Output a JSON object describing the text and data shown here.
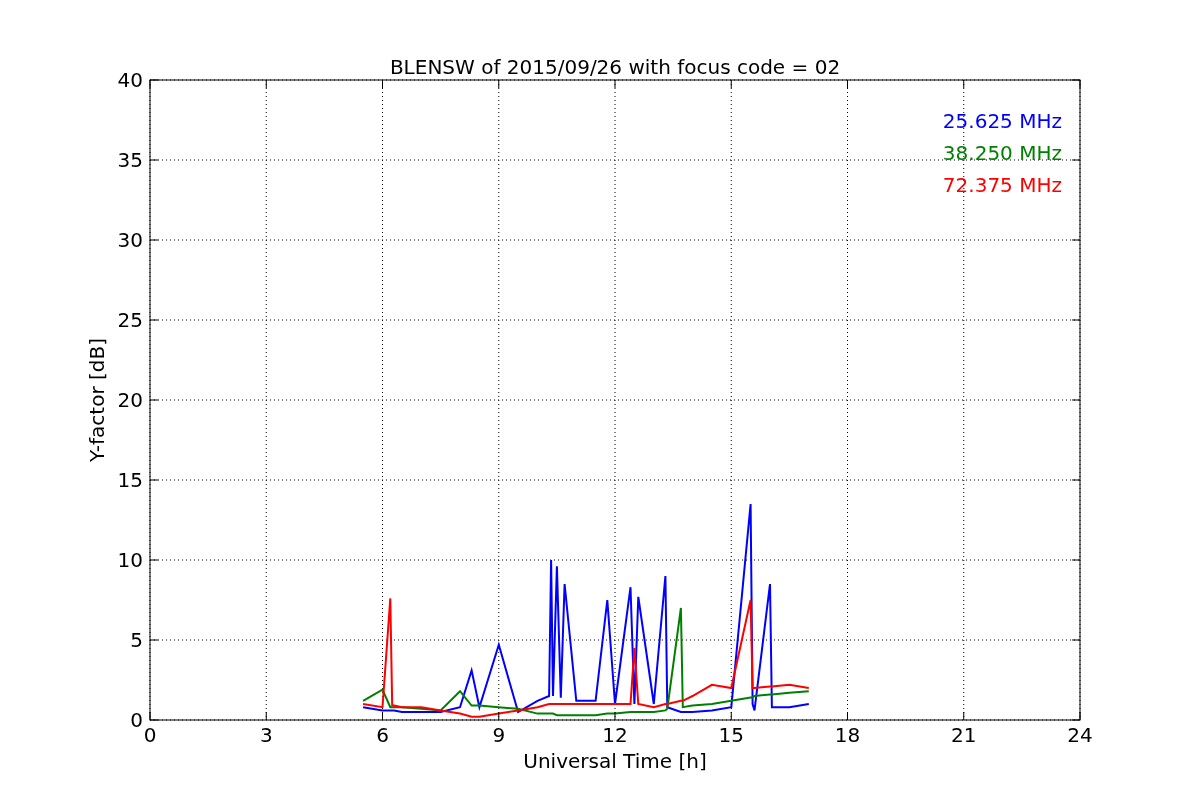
{
  "chart_data": {
    "type": "line",
    "title": "BLENSW of 2015/09/26 with focus code = 02",
    "xlabel": "Universal Time [h]",
    "ylabel": "Y-factor [dB]",
    "x": [
      5.5,
      6.0,
      6.2,
      6.25,
      6.3,
      6.5,
      7,
      7.5,
      8,
      8.3,
      8.5,
      9,
      9.5,
      10,
      10.3,
      10.35,
      10.4,
      10.5,
      10.6,
      10.7,
      11,
      11.5,
      11.8,
      12,
      12.4,
      12.5,
      12.6,
      13,
      13.3,
      13.35,
      13.7,
      13.75,
      14,
      14.5,
      15,
      15.5,
      15.55,
      15.6,
      16,
      16.05,
      16.5,
      17
    ],
    "series": [
      {
        "name": "25.625 MHz",
        "color": "#0000ff",
        "values": [
          0.8,
          0.6,
          0.6,
          0.6,
          0.6,
          0.5,
          0.5,
          0.5,
          0.8,
          3.1,
          0.8,
          4.7,
          0.5,
          1.2,
          1.5,
          10.0,
          1.5,
          9.6,
          1.4,
          8.5,
          1.2,
          1.2,
          7.5,
          1.0,
          8.3,
          1.0,
          7.7,
          1.0,
          9.0,
          0.8,
          0.5,
          0.5,
          0.5,
          0.6,
          0.8,
          13.5,
          1.0,
          0.6,
          8.5,
          0.8,
          0.8,
          1.0
        ]
      },
      {
        "name": "38.250 MHz",
        "color": "#008000",
        "values": [
          1.2,
          1.9,
          0.8,
          0.8,
          0.8,
          0.8,
          0.7,
          0.6,
          1.8,
          0.9,
          0.9,
          0.8,
          0.7,
          0.4,
          0.4,
          0.4,
          0.4,
          0.3,
          0.3,
          0.3,
          0.3,
          0.3,
          0.4,
          0.4,
          0.5,
          0.5,
          0.5,
          0.5,
          0.6,
          0.7,
          7.0,
          0.8,
          0.9,
          1.0,
          1.2,
          1.4,
          1.4,
          1.5,
          1.6,
          1.6,
          1.7,
          1.8
        ]
      },
      {
        "name": "72.375 MHz",
        "color": "#ff0000",
        "values": [
          1.0,
          0.8,
          7.6,
          0.9,
          0.9,
          0.8,
          0.8,
          0.6,
          0.4,
          0.2,
          0.2,
          0.4,
          0.6,
          0.8,
          1.0,
          1.0,
          1.0,
          1.0,
          1.0,
          1.0,
          1.0,
          1.0,
          1.0,
          1.0,
          1.0,
          4.5,
          1.0,
          0.8,
          1.0,
          1.0,
          1.2,
          1.2,
          1.5,
          2.2,
          2.0,
          7.5,
          2.0,
          2.0,
          2.1,
          2.1,
          2.2,
          2.0
        ]
      }
    ],
    "xlim": [
      0,
      24
    ],
    "ylim": [
      0,
      40
    ],
    "xticks": [
      0,
      3,
      6,
      9,
      12,
      15,
      18,
      21,
      24
    ],
    "yticks": [
      0,
      5,
      10,
      15,
      20,
      25,
      30,
      35,
      40
    ],
    "grid": true
  }
}
